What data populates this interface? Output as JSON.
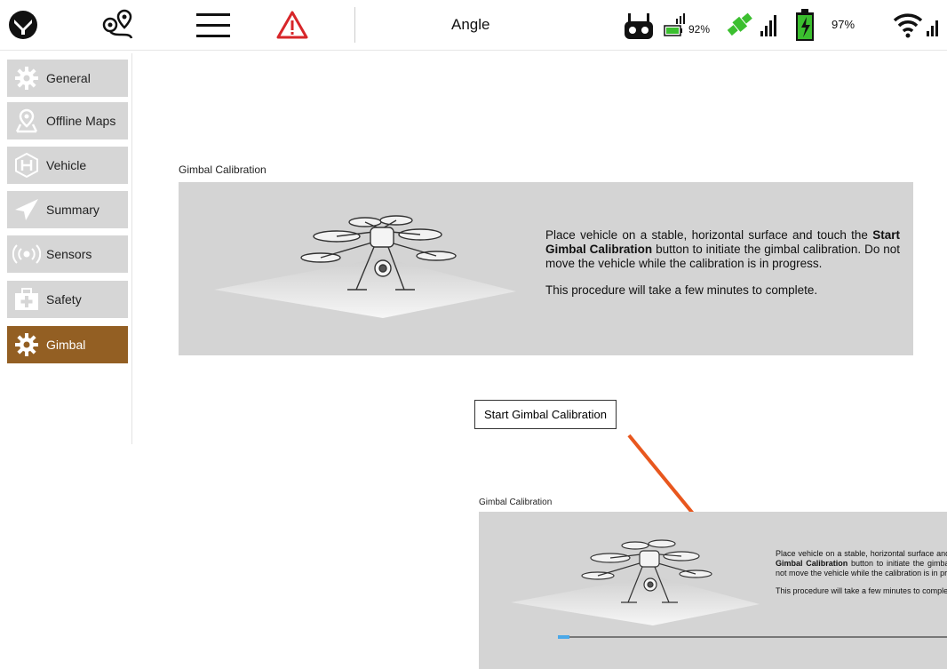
{
  "toolbar": {
    "flight_mode": "Angle",
    "rc_battery_pct": "92%",
    "vehicle_battery_pct": "97%"
  },
  "sidebar": {
    "items": [
      {
        "label": "General",
        "icon": "gear-icon"
      },
      {
        "label": "Offline Maps",
        "icon": "map-pin-icon"
      },
      {
        "label": "Vehicle",
        "icon": "hexagon-h-icon"
      },
      {
        "label": "Summary",
        "icon": "paper-plane-icon"
      },
      {
        "label": "Sensors",
        "icon": "radio-waves-icon"
      },
      {
        "label": "Safety",
        "icon": "first-aid-kit-icon"
      },
      {
        "label": "Gimbal",
        "icon": "gear-icon",
        "active": true
      }
    ]
  },
  "main": {
    "section_title": "Gimbal Calibration",
    "instruction_pre": "Place vehicle on a stable, horizontal surface and touch the ",
    "instruction_bold": "Start Gimbal Calibration",
    "instruction_post": " button to initiate the gimbal calibration. Do not move the vehicle while the calibration is in progress.",
    "instruction_note": "This procedure will take a few minutes to complete.",
    "start_button_label": "Start Gimbal Calibration"
  },
  "inset": {
    "section_title": "Gimbal Calibration",
    "progress": 0.03
  },
  "colors": {
    "active_item": "#935f23",
    "panel": "#d4d4d4",
    "arrow": "#e8571e",
    "progress": "#4aa8e8"
  }
}
